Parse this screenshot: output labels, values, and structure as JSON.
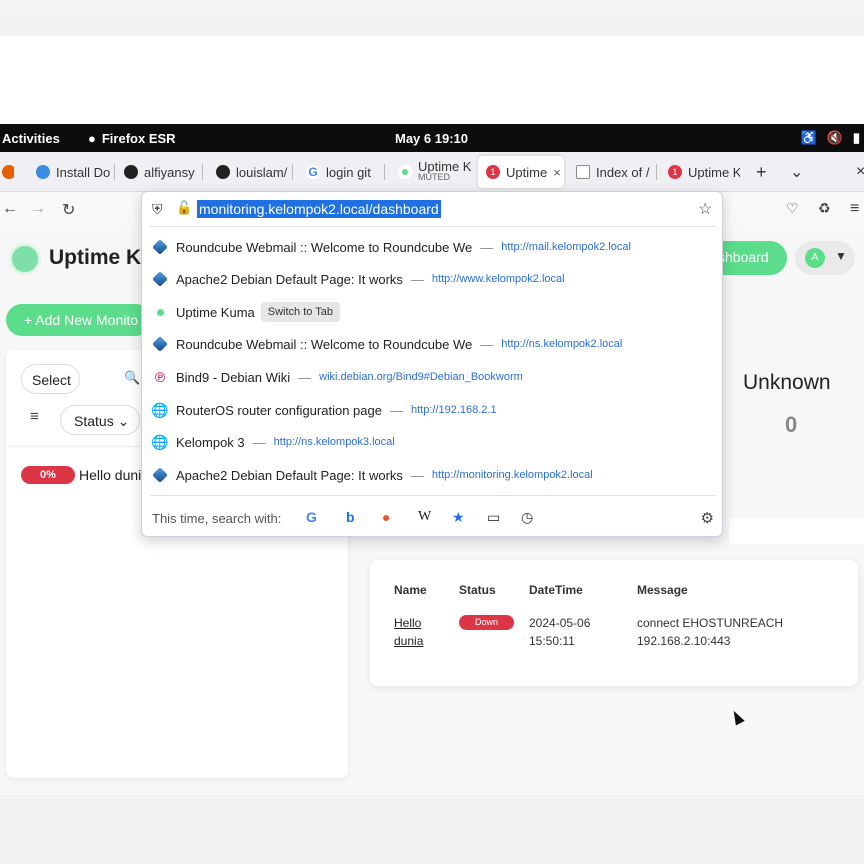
{
  "desktop": {
    "activities": "Activities",
    "app_name": "Firefox ESR",
    "clock": "May 6  19:10",
    "tray_icons": [
      "accessibility-icon",
      "volume-muted-icon",
      "battery-icon"
    ]
  },
  "tabs": [
    {
      "label": "Install Do",
      "icon": "globe-icon",
      "color": "#3b8de0"
    },
    {
      "label": "alfiyansy",
      "icon": "github-icon",
      "color": "#222222"
    },
    {
      "label": "louislam/",
      "icon": "github-icon",
      "color": "#222222"
    },
    {
      "label": "login git",
      "icon": "google-icon",
      "color": "#4285f4"
    },
    {
      "label": "Uptime K",
      "sub": "MUTED",
      "icon": "uptime-kuma-icon",
      "color": "#5cdd8b"
    },
    {
      "label": "Uptime",
      "icon": "uptime-kuma-alert-icon",
      "color": "#dc3545",
      "badge": "1",
      "active": true
    },
    {
      "label": "Index of /",
      "icon": "page-icon",
      "color": "#666666"
    },
    {
      "label": "Uptime K",
      "icon": "uptime-kuma-alert-icon",
      "color": "#dc3545",
      "badge": "1"
    }
  ],
  "tab_controls": {
    "new_tab": "+",
    "list_all": "⌄",
    "close_window": "×"
  },
  "urlbar": {
    "url": "monitoring.kelompok2.local/dashboard",
    "suggestions": [
      {
        "title": "Roundcube Webmail :: Welcome to Roundcube We",
        "url": "http://mail.kelompok2.local",
        "icon": "debian-cube-icon"
      },
      {
        "title": "Apache2 Debian Default Page: It works",
        "url": "http://www.kelompok2.local",
        "icon": "debian-cube-icon"
      },
      {
        "title": "Uptime Kuma",
        "action": "Switch to Tab",
        "icon": "uptime-kuma-icon"
      },
      {
        "title": "Roundcube Webmail :: Welcome to Roundcube We",
        "url": "http://ns.kelompok2.local",
        "icon": "debian-cube-icon"
      },
      {
        "title": "Bind9 - Debian Wiki",
        "url": "wiki.debian.org/Bind9#Debian_Bookworm",
        "icon": "debian-swirl-icon"
      },
      {
        "title": "RouterOS router configuration page",
        "url": "http://192.168.2.1",
        "icon": "globe-icon"
      },
      {
        "title": "Kelompok 3",
        "url": "http://ns.kelompok3.local",
        "icon": "globe-icon"
      },
      {
        "title": "Apache2 Debian Default Page: It works",
        "url": "http://monitoring.kelompok2.local",
        "icon": "debian-cube-icon"
      }
    ],
    "search_with_label": "This time, search with:",
    "engines": [
      {
        "name": "google-icon",
        "glyph": "G",
        "color": "#4285f4"
      },
      {
        "name": "bing-icon",
        "glyph": "b",
        "color": "#1a73e8"
      },
      {
        "name": "duckduckgo-icon",
        "glyph": "●",
        "color": "#de5833"
      },
      {
        "name": "wikipedia-icon",
        "glyph": "W",
        "color": "#222222"
      },
      {
        "name": "bookmarks-icon",
        "glyph": "★",
        "color": "#1f6fe5"
      },
      {
        "name": "tabs-icon",
        "glyph": "▭",
        "color": "#333333"
      },
      {
        "name": "history-icon",
        "glyph": "◷",
        "color": "#333333"
      }
    ]
  },
  "kuma": {
    "title": "Uptime K",
    "dashboard_btn": "shboard",
    "avatar": "A",
    "add_btn": "+ Add New Monito",
    "select": "Select",
    "status_filter": "Status ⌄",
    "monitor": {
      "percent": "0%",
      "name": "Hello duni"
    },
    "unknown_label": "Unknown",
    "unknown_value": "0",
    "events": {
      "headers": [
        "Name",
        "Status",
        "DateTime",
        "Message"
      ],
      "row": {
        "name_line1": "Hello",
        "name_line2": "dunia",
        "status": "Down",
        "date": "2024-05-06",
        "time": "15:50:11",
        "msg_line1": "connect EHOSTUNREACH",
        "msg_line2": "192.168.2.10:443"
      }
    }
  }
}
